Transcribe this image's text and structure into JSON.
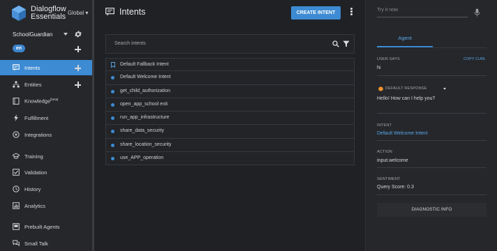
{
  "brand": {
    "line1": "Dialogflow",
    "line2": "Essentials",
    "region": "Global"
  },
  "agent": {
    "name": "SchoolGuardian",
    "language": "en"
  },
  "nav": [
    {
      "label": "Intents",
      "icon": "chat-icon",
      "active": true
    },
    {
      "label": "Entities",
      "icon": "entities-icon"
    },
    {
      "label": "Knowledge",
      "icon": "book-icon",
      "badge": "[beta]"
    },
    {
      "label": "Fulfillment",
      "icon": "bolt-icon"
    },
    {
      "label": "Integrations",
      "icon": "integrations-icon"
    },
    {
      "label": "Training",
      "icon": "graduation-cap-icon"
    },
    {
      "label": "Validation",
      "icon": "check-box-icon"
    },
    {
      "label": "History",
      "icon": "clock-icon"
    },
    {
      "label": "Analytics",
      "icon": "bar-chart-icon"
    },
    {
      "label": "Prebuilt Agents",
      "icon": "prebuilt-agents-icon"
    },
    {
      "label": "Small Talk",
      "icon": "small-talk-icon"
    }
  ],
  "main": {
    "title": "Intents",
    "create_label": "CREATE INTENT",
    "search_placeholder": "Search intents",
    "intents": [
      "Default Fallback Intent",
      "Default Welcome Intent",
      "get_child_authorization",
      "open_app_school exit",
      "run_app_infrastructure",
      "share_data_security",
      "share_location_security",
      "use_APP_operation"
    ]
  },
  "panel": {
    "try_placeholder": "Try it now",
    "tab": "Agent",
    "user_says_label": "USER SAYS",
    "copy_curl": "COPY CURL",
    "user_says_value": "hi",
    "default_response_label": "DEFAULT RESPONSE",
    "default_response_value": "Hello! How can I help you?",
    "intent_label": "INTENT",
    "intent_value": "Default Welcome Intent",
    "action_label": "ACTION",
    "action_value": "input.welcome",
    "sentiment_label": "SENTIMENT",
    "sentiment_value": "Query Score: 0.3",
    "diagnostic_label": "DIAGNOSTIC INFO"
  },
  "colors": {
    "accent": "#3d8bd3",
    "link": "#5aa7e6",
    "response_icon": "#f0932b"
  }
}
